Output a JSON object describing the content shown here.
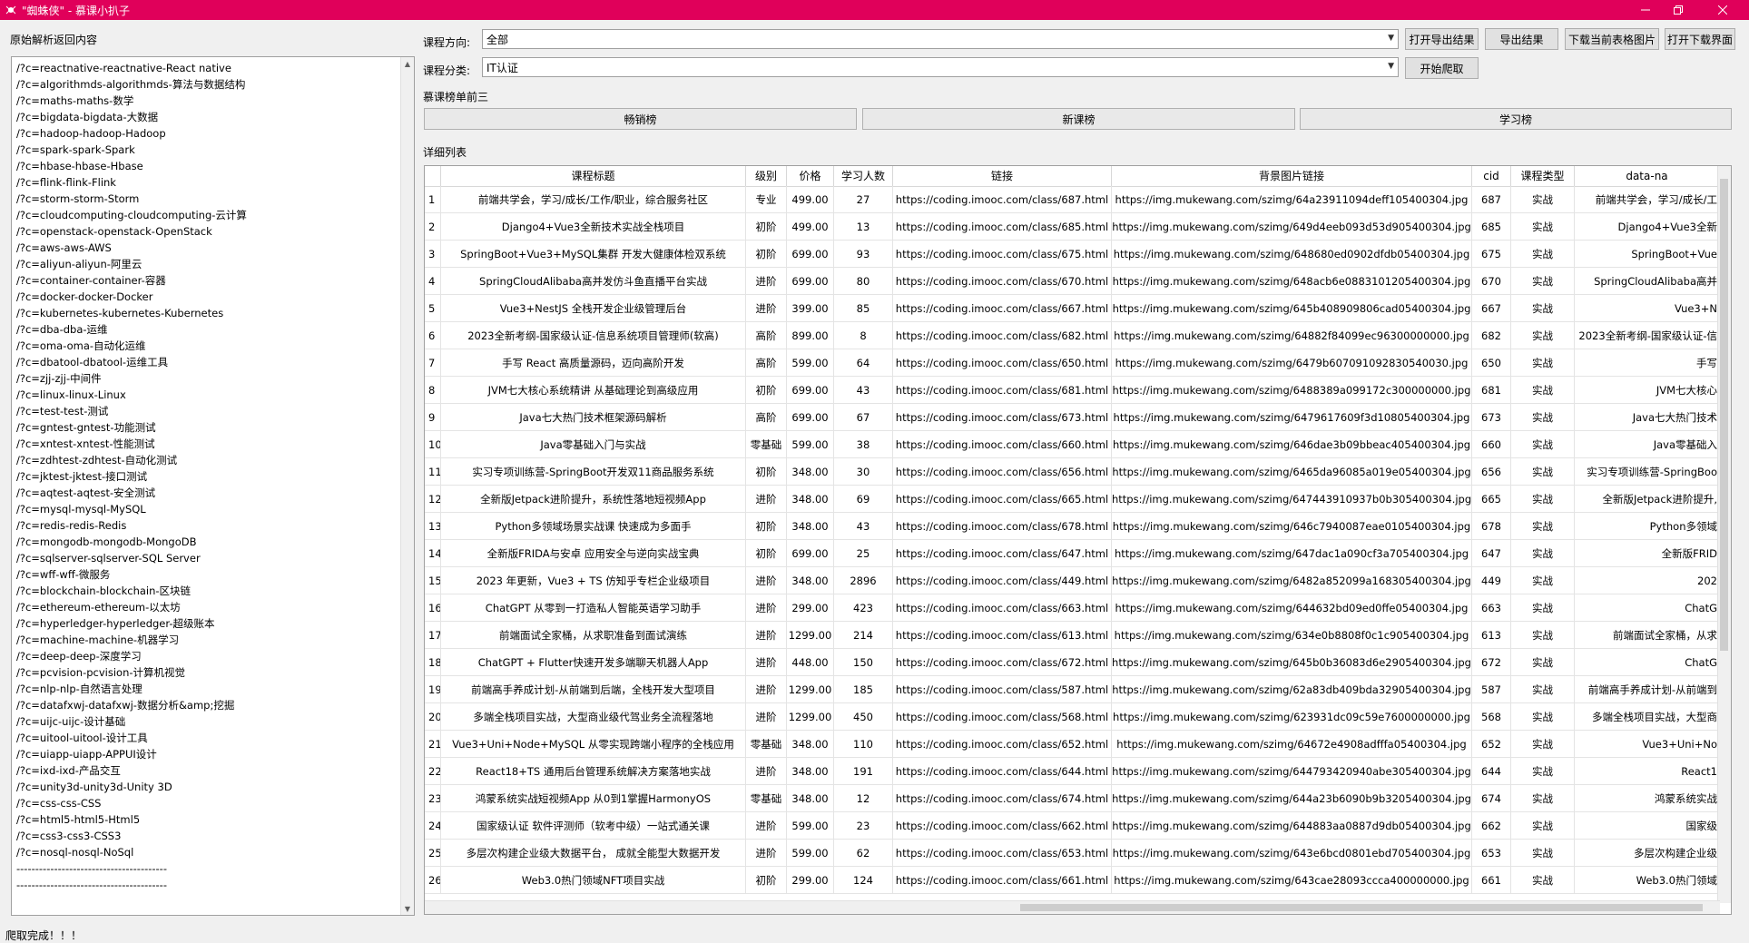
{
  "window": {
    "title": "\"蜘蛛侠\" - 慕课小扒子",
    "accent": "#e0005a"
  },
  "left": {
    "label": "原始解析返回内容",
    "lines": [
      "/?c=reactnative-reactnative-React native",
      "/?c=algorithmds-algorithmds-算法与数据结构",
      "/?c=maths-maths-数学",
      "/?c=bigdata-bigdata-大数据",
      "/?c=hadoop-hadoop-Hadoop",
      "/?c=spark-spark-Spark",
      "/?c=hbase-hbase-Hbase",
      "/?c=flink-flink-Flink",
      "/?c=storm-storm-Storm",
      "/?c=cloudcomputing-cloudcomputing-云计算",
      "/?c=openstack-openstack-OpenStack",
      "/?c=aws-aws-AWS",
      "/?c=aliyun-aliyun-阿里云",
      "/?c=container-container-容器",
      "/?c=docker-docker-Docker",
      "/?c=kubernetes-kubernetes-Kubernetes",
      "/?c=dba-dba-运维",
      "/?c=oma-oma-自动化运维",
      "/?c=dbatool-dbatool-运维工具",
      "/?c=zjj-zjj-中间件",
      "/?c=linux-linux-Linux",
      "/?c=test-test-测试",
      "/?c=gntest-gntest-功能测试",
      "/?c=xntest-xntest-性能测试",
      "/?c=zdhtest-zdhtest-自动化测试",
      "/?c=jktest-jktest-接口测试",
      "/?c=aqtest-aqtest-安全测试",
      "/?c=mysql-mysql-MySQL",
      "/?c=redis-redis-Redis",
      "/?c=mongodb-mongodb-MongoDB",
      "/?c=sqlserver-sqlserver-SQL Server",
      "/?c=wff-wff-微服务",
      "/?c=blockchain-blockchain-区块链",
      "/?c=ethereum-ethereum-以太坊",
      "/?c=hyperledger-hyperledger-超级账本",
      "/?c=machine-machine-机器学习",
      "/?c=deep-deep-深度学习",
      "/?c=pcvision-pcvision-计算机视觉",
      "/?c=nlp-nlp-自然语言处理",
      "/?c=datafxwj-datafxwj-数据分析&amp;挖掘",
      "/?c=uijc-uijc-设计基础",
      "/?c=uitool-uitool-设计工具",
      "/?c=uiapp-uiapp-APPUI设计",
      "/?c=ixd-ixd-产品交互",
      "/?c=unity3d-unity3d-Unity 3D",
      "/?c=css-css-CSS",
      "/?c=html5-html5-Html5",
      "/?c=css3-css3-CSS3",
      "/?c=nosql-nosql-NoSql",
      "----------------------------------------",
      "----------------------------------------"
    ]
  },
  "controls": {
    "direction_label": "课程方向:",
    "direction_value": "全部",
    "category_label": "课程分类:",
    "category_value": "IT认证",
    "btn_open_export": "打开导出结果",
    "btn_export": "导出结果",
    "btn_download_img": "下载当前表格图片",
    "btn_open_download": "打开下载界面",
    "btn_start": "开始爬取",
    "top3_label": "慕课榜单前三",
    "tab_best": "畅销榜",
    "tab_new": "新课榜",
    "tab_study": "学习榜",
    "detail_label": "详细列表"
  },
  "table": {
    "headers": [
      "",
      "课程标题",
      "级别",
      "价格",
      "学习人数",
      "链接",
      "背景图片链接",
      "cid",
      "课程类型",
      "data-na"
    ],
    "rows": [
      [
        "1",
        "前端共学会，学习/成长/工作/职业，综合服务社区",
        "专业",
        "499.00",
        "27",
        "https://coding.imooc.com/class/687.html",
        "https://img.mukewang.com/szimg/64a23911094deff105400304.jpg",
        "687",
        "实战",
        "前端共学会，学习/成长/工"
      ],
      [
        "2",
        "Django4+Vue3全新技术实战全栈项目",
        "初阶",
        "499.00",
        "13",
        "https://coding.imooc.com/class/685.html",
        "https://img.mukewang.com/szimg/649d4eeb093d53d905400304.jpg",
        "685",
        "实战",
        "Django4+Vue3全新"
      ],
      [
        "3",
        "SpringBoot+Vue3+MySQL集群 开发大健康体检双系统",
        "初阶",
        "699.00",
        "93",
        "https://coding.imooc.com/class/675.html",
        "https://img.mukewang.com/szimg/648680ed0902dfdb05400304.jpg",
        "675",
        "实战",
        "SpringBoot+Vue"
      ],
      [
        "4",
        "SpringCloudAlibaba高并发仿斗鱼直播平台实战",
        "进阶",
        "699.00",
        "80",
        "https://coding.imooc.com/class/670.html",
        "https://img.mukewang.com/szimg/648acb6e0883101205400304.jpg",
        "670",
        "实战",
        "SpringCloudAlibaba高并"
      ],
      [
        "5",
        "Vue3+NestJS 全栈开发企业级管理后台",
        "进阶",
        "399.00",
        "85",
        "https://coding.imooc.com/class/667.html",
        "https://img.mukewang.com/szimg/645b408909806cad05400304.jpg",
        "667",
        "实战",
        "Vue3+N"
      ],
      [
        "6",
        "2023全新考纲-国家级认证-信息系统项目管理师(软高)",
        "高阶",
        "899.00",
        "8",
        "https://coding.imooc.com/class/682.html",
        "https://img.mukewang.com/szimg/64882f84099ec96300000000.jpg",
        "682",
        "实战",
        "2023全新考纲-国家级认证-信"
      ],
      [
        "7",
        "手写 React 高质量源码，迈向高阶开发",
        "高阶",
        "599.00",
        "64",
        "https://coding.imooc.com/class/650.html",
        "https://img.mukewang.com/szimg/6479b607091092830540030.jpg",
        "650",
        "实战",
        "手写"
      ],
      [
        "8",
        "JVM七大核心系统精讲 从基础理论到高级应用",
        "初阶",
        "699.00",
        "43",
        "https://coding.imooc.com/class/681.html",
        "https://img.mukewang.com/szimg/6488389a099172c300000000.jpg",
        "681",
        "实战",
        "JVM七大核心"
      ],
      [
        "9",
        "Java七大热门技术框架源码解析",
        "高阶",
        "699.00",
        "67",
        "https://coding.imooc.com/class/673.html",
        "https://img.mukewang.com/szimg/6479617609f3d10805400304.jpg",
        "673",
        "实战",
        "Java七大热门技术"
      ],
      [
        "10",
        "Java零基础入门与实战",
        "零基础",
        "599.00",
        "38",
        "https://coding.imooc.com/class/660.html",
        "https://img.mukewang.com/szimg/646dae3b09bbeac405400304.jpg",
        "660",
        "实战",
        "Java零基础入"
      ],
      [
        "11",
        "实习专项训练营-SpringBoot开发双11商品服务系统",
        "初阶",
        "348.00",
        "30",
        "https://coding.imooc.com/class/656.html",
        "https://img.mukewang.com/szimg/6465da96085a019e05400304.jpg",
        "656",
        "实战",
        "实习专项训练营-SpringBoo"
      ],
      [
        "12",
        "全新版Jetpack进阶提升，系统性落地短视频App",
        "进阶",
        "348.00",
        "69",
        "https://coding.imooc.com/class/665.html",
        "https://img.mukewang.com/szimg/647443910937b0b305400304.jpg",
        "665",
        "实战",
        "全新版Jetpack进阶提升,"
      ],
      [
        "13",
        "Python多领域场景实战课   快速成为多面手",
        "初阶",
        "348.00",
        "43",
        "https://coding.imooc.com/class/678.html",
        "https://img.mukewang.com/szimg/646c7940087eae0105400304.jpg",
        "678",
        "实战",
        "Python多领域"
      ],
      [
        "14",
        "全新版FRIDA与安卓 应用安全与逆向实战宝典",
        "初阶",
        "699.00",
        "25",
        "https://coding.imooc.com/class/647.html",
        "https://img.mukewang.com/szimg/647dac1a090cf3a705400304.jpg",
        "647",
        "实战",
        "全新版FRID"
      ],
      [
        "15",
        "2023 年更新，Vue3 + TS 仿知乎专栏企业级项目",
        "进阶",
        "348.00",
        "2896",
        "https://coding.imooc.com/class/449.html",
        "https://img.mukewang.com/szimg/6482a852099a168305400304.jpg",
        "449",
        "实战",
        "202"
      ],
      [
        "16",
        "ChatGPT 从零到一打造私人智能英语学习助手",
        "进阶",
        "299.00",
        "423",
        "https://coding.imooc.com/class/663.html",
        "https://img.mukewang.com/szimg/644632bd09ed0ffe05400304.jpg",
        "663",
        "实战",
        "ChatG"
      ],
      [
        "17",
        "前端面试全家桶，从求职准备到面试演练",
        "进阶",
        "1299.00",
        "214",
        "https://coding.imooc.com/class/613.html",
        "https://img.mukewang.com/szimg/634e0b8808f0c1c905400304.jpg",
        "613",
        "实战",
        "前端面试全家桶，从求"
      ],
      [
        "18",
        "ChatGPT + Flutter快速开发多端聊天机器人App",
        "进阶",
        "448.00",
        "150",
        "https://coding.imooc.com/class/672.html",
        "https://img.mukewang.com/szimg/645b0b36083d6e2905400304.jpg",
        "672",
        "实战",
        "ChatG"
      ],
      [
        "19",
        "前端高手养成计划-从前端到后端，全栈开发大型项目",
        "进阶",
        "1299.00",
        "185",
        "https://coding.imooc.com/class/587.html",
        "https://img.mukewang.com/szimg/62a83db409bda32905400304.jpg",
        "587",
        "实战",
        "前端高手养成计划-从前端到"
      ],
      [
        "20",
        "多端全栈项目实战，大型商业级代驾业务全流程落地",
        "进阶",
        "1299.00",
        "450",
        "https://coding.imooc.com/class/568.html",
        "https://img.mukewang.com/szimg/623931dc09c59e7600000000.jpg",
        "568",
        "实战",
        "多端全栈项目实战，大型商"
      ],
      [
        "21",
        "Vue3+Uni+Node+MySQL 从零实现跨端小程序的全栈应用",
        "零基础",
        "348.00",
        "110",
        "https://coding.imooc.com/class/652.html",
        "https://img.mukewang.com/szimg/64672e4908adfffa05400304.jpg",
        "652",
        "实战",
        "Vue3+Uni+No"
      ],
      [
        "22",
        "React18+TS 通用后台管理系统解决方案落地实战",
        "进阶",
        "348.00",
        "191",
        "https://coding.imooc.com/class/644.html",
        "https://img.mukewang.com/szimg/644793420940abe305400304.jpg",
        "644",
        "实战",
        "React1"
      ],
      [
        "23",
        "鸿蒙系统实战短视频App 从0到1掌握HarmonyOS",
        "零基础",
        "348.00",
        "12",
        "https://coding.imooc.com/class/674.html",
        "https://img.mukewang.com/szimg/644a23b6090b9b3205400304.jpg",
        "674",
        "实战",
        "鸿蒙系统实战"
      ],
      [
        "24",
        "国家级认证 软件评测师（软考中级）一站式通关课",
        "进阶",
        "599.00",
        "23",
        "https://coding.imooc.com/class/662.html",
        "https://img.mukewang.com/szimg/644883aa0887d9db05400304.jpg",
        "662",
        "实战",
        "国家级"
      ],
      [
        "25",
        "多层次构建企业级大数据平台， 成就全能型大数据开发",
        "进阶",
        "599.00",
        "62",
        "https://coding.imooc.com/class/653.html",
        "https://img.mukewang.com/szimg/643e6bcd0801ebd705400304.jpg",
        "653",
        "实战",
        "多层次构建企业级"
      ],
      [
        "26",
        "Web3.0热门领域NFT项目实战",
        "初阶",
        "299.00",
        "124",
        "https://coding.imooc.com/class/661.html",
        "https://img.mukewang.com/szimg/643cae28093ccca400000000.jpg",
        "661",
        "实战",
        "Web3.0热门领域"
      ]
    ]
  },
  "status": "爬取完成！！！"
}
